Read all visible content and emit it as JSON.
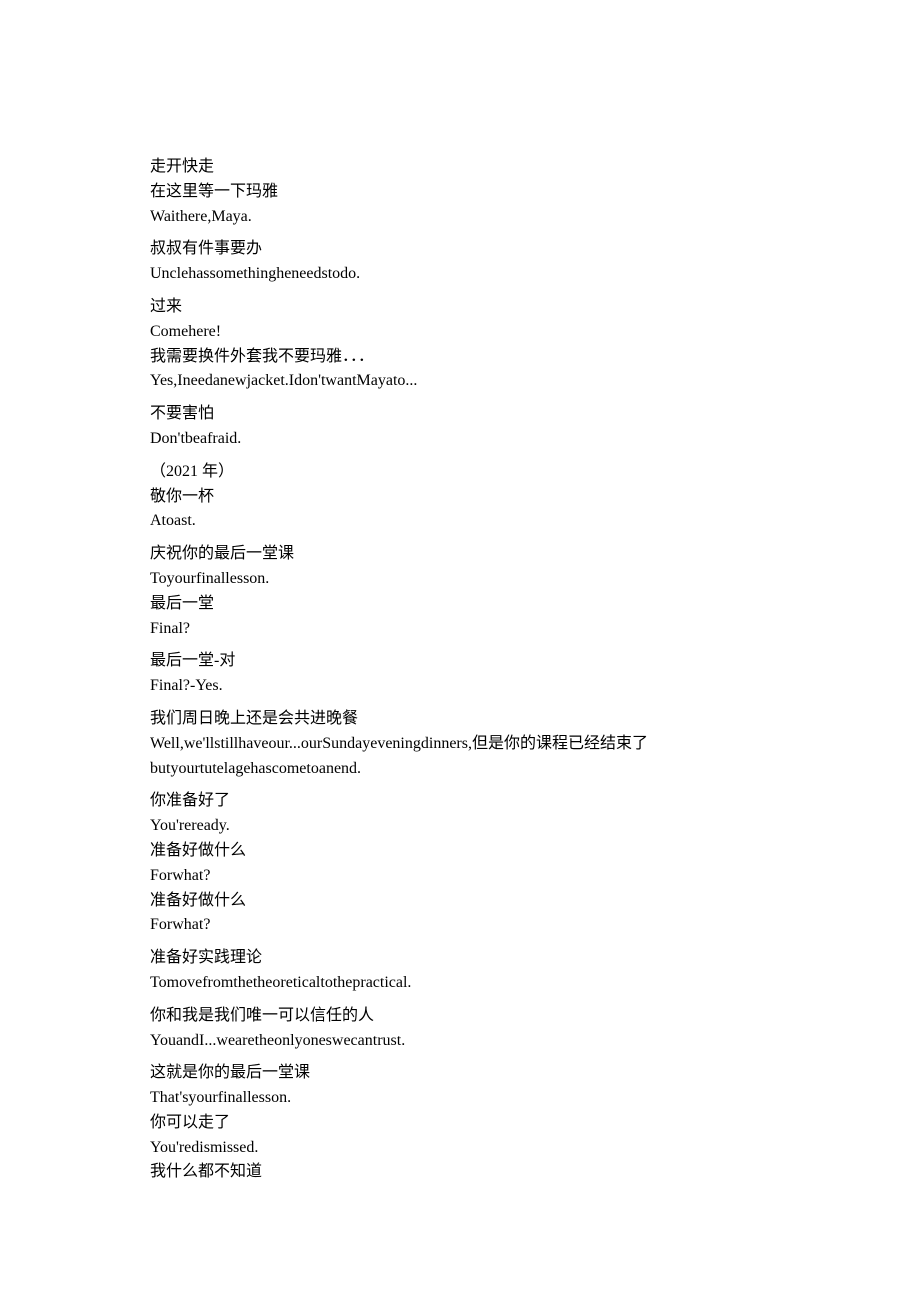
{
  "groups": [
    {
      "lines": [
        "走开快走",
        "在这里等一下玛雅",
        "Waithere,Maya."
      ]
    },
    {
      "lines": [
        "叔叔有件事要办",
        "Unclehassomethingheneedstodo."
      ]
    },
    {
      "lines": [
        "过来",
        "Comehere!",
        "我需要换件外套我不要玛雅．．．",
        "Yes,Ineedanewjacket.Idon'twantMayato..."
      ]
    },
    {
      "lines": [
        "不要害怕",
        "Don'tbeafraid."
      ]
    },
    {
      "lines": [
        "（2021 年）",
        "敬你一杯",
        "Atoast."
      ]
    },
    {
      "lines": [
        "庆祝你的最后一堂课",
        "Toyourfinallesson.",
        "最后一堂",
        "Final?"
      ]
    },
    {
      "lines": [
        "最后一堂-对",
        "Final?-Yes."
      ]
    },
    {
      "lines": [
        "我们周日晚上还是会共进晚餐",
        "Well,we'llstillhaveour...ourSundayeveningdinners,但是你的课程已经结束了",
        "butyourtutelagehascometoanend."
      ]
    },
    {
      "lines": [
        "你准备好了",
        "You'reready.",
        "准备好做什么",
        "Forwhat?",
        "准备好做什么",
        "Forwhat?"
      ]
    },
    {
      "lines": [
        "准备好实践理论",
        "Tomovefromthetheoreticaltothepractical."
      ]
    },
    {
      "lines": [
        "你和我是我们唯一可以信任的人",
        "YouandI...wearetheonlyoneswecantrust."
      ]
    },
    {
      "lines": [
        "这就是你的最后一堂课",
        "That'syourfinallesson.",
        "你可以走了",
        "You'redismissed.",
        "我什么都不知道"
      ]
    }
  ]
}
